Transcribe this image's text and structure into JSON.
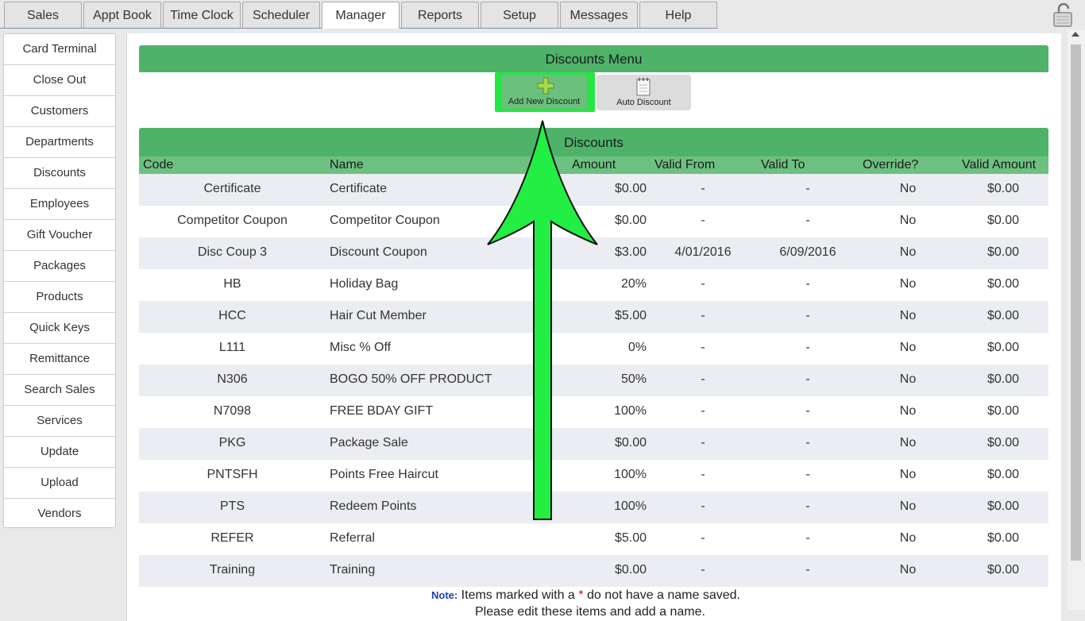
{
  "tabs": [
    "Sales",
    "Appt Book",
    "Time Clock",
    "Scheduler",
    "Manager",
    "Reports",
    "Setup",
    "Messages",
    "Help"
  ],
  "active_tab": "Manager",
  "sidebar": {
    "items": [
      "Card Terminal",
      "Close Out",
      "Customers",
      "Departments",
      "Discounts",
      "Employees",
      "Gift Voucher",
      "Packages",
      "Products",
      "Quick Keys",
      "Remittance",
      "Search Sales",
      "Services",
      "Update",
      "Upload",
      "Vendors"
    ]
  },
  "menu": {
    "title": "Discounts Menu",
    "add_label": "Add New Discount",
    "auto_label": "Auto Discount"
  },
  "table": {
    "title": "Discounts",
    "headers": {
      "code": "Code",
      "name": "Name",
      "amount": "Amount",
      "valid_from": "Valid From",
      "valid_to": "Valid To",
      "override": "Override?",
      "valid_amount": "Valid Amount"
    },
    "rows": [
      [
        "Certificate",
        "Certificate",
        "$0.00",
        "-",
        "-",
        "No",
        "$0.00"
      ],
      [
        "Competitor Coupon",
        "Competitor Coupon",
        "$0.00",
        "-",
        "-",
        "No",
        "$0.00"
      ],
      [
        "Disc Coup 3",
        "Discount Coupon",
        "$3.00",
        "4/01/2016",
        "6/09/2016",
        "No",
        "$0.00"
      ],
      [
        "HB",
        "Holiday Bag",
        "20%",
        "-",
        "-",
        "No",
        "$0.00"
      ],
      [
        "HCC",
        "Hair Cut Member",
        "$5.00",
        "-",
        "-",
        "No",
        "$0.00"
      ],
      [
        "L111",
        "Misc % Off",
        "0%",
        "-",
        "-",
        "No",
        "$0.00"
      ],
      [
        "N306",
        "BOGO 50% OFF PRODUCT",
        "50%",
        "-",
        "-",
        "No",
        "$0.00"
      ],
      [
        "N7098",
        "FREE BDAY GIFT",
        "100%",
        "-",
        "-",
        "No",
        "$0.00"
      ],
      [
        "PKG",
        "Package Sale",
        "$0.00",
        "-",
        "-",
        "No",
        "$0.00"
      ],
      [
        "PNTSFH",
        "Points Free Haircut",
        "100%",
        "-",
        "-",
        "No",
        "$0.00"
      ],
      [
        "PTS",
        "Redeem Points",
        "100%",
        "-",
        "-",
        "No",
        "$0.00"
      ],
      [
        "REFER",
        "Referral",
        "$5.00",
        "-",
        "-",
        "No",
        "$0.00"
      ],
      [
        "Training",
        "Training",
        "$0.00",
        "-",
        "-",
        "No",
        "$0.00"
      ]
    ]
  },
  "note": {
    "label": "Note:",
    "text_before": "Items marked with a",
    "star": "*",
    "text_after": "do not have a name saved.",
    "line2": "Please edit these items and add a name."
  },
  "colors": {
    "header_green": "#4eb369",
    "column_green": "#6dc180",
    "highlight": "#22e843",
    "row_alt": "#ebedf2"
  }
}
